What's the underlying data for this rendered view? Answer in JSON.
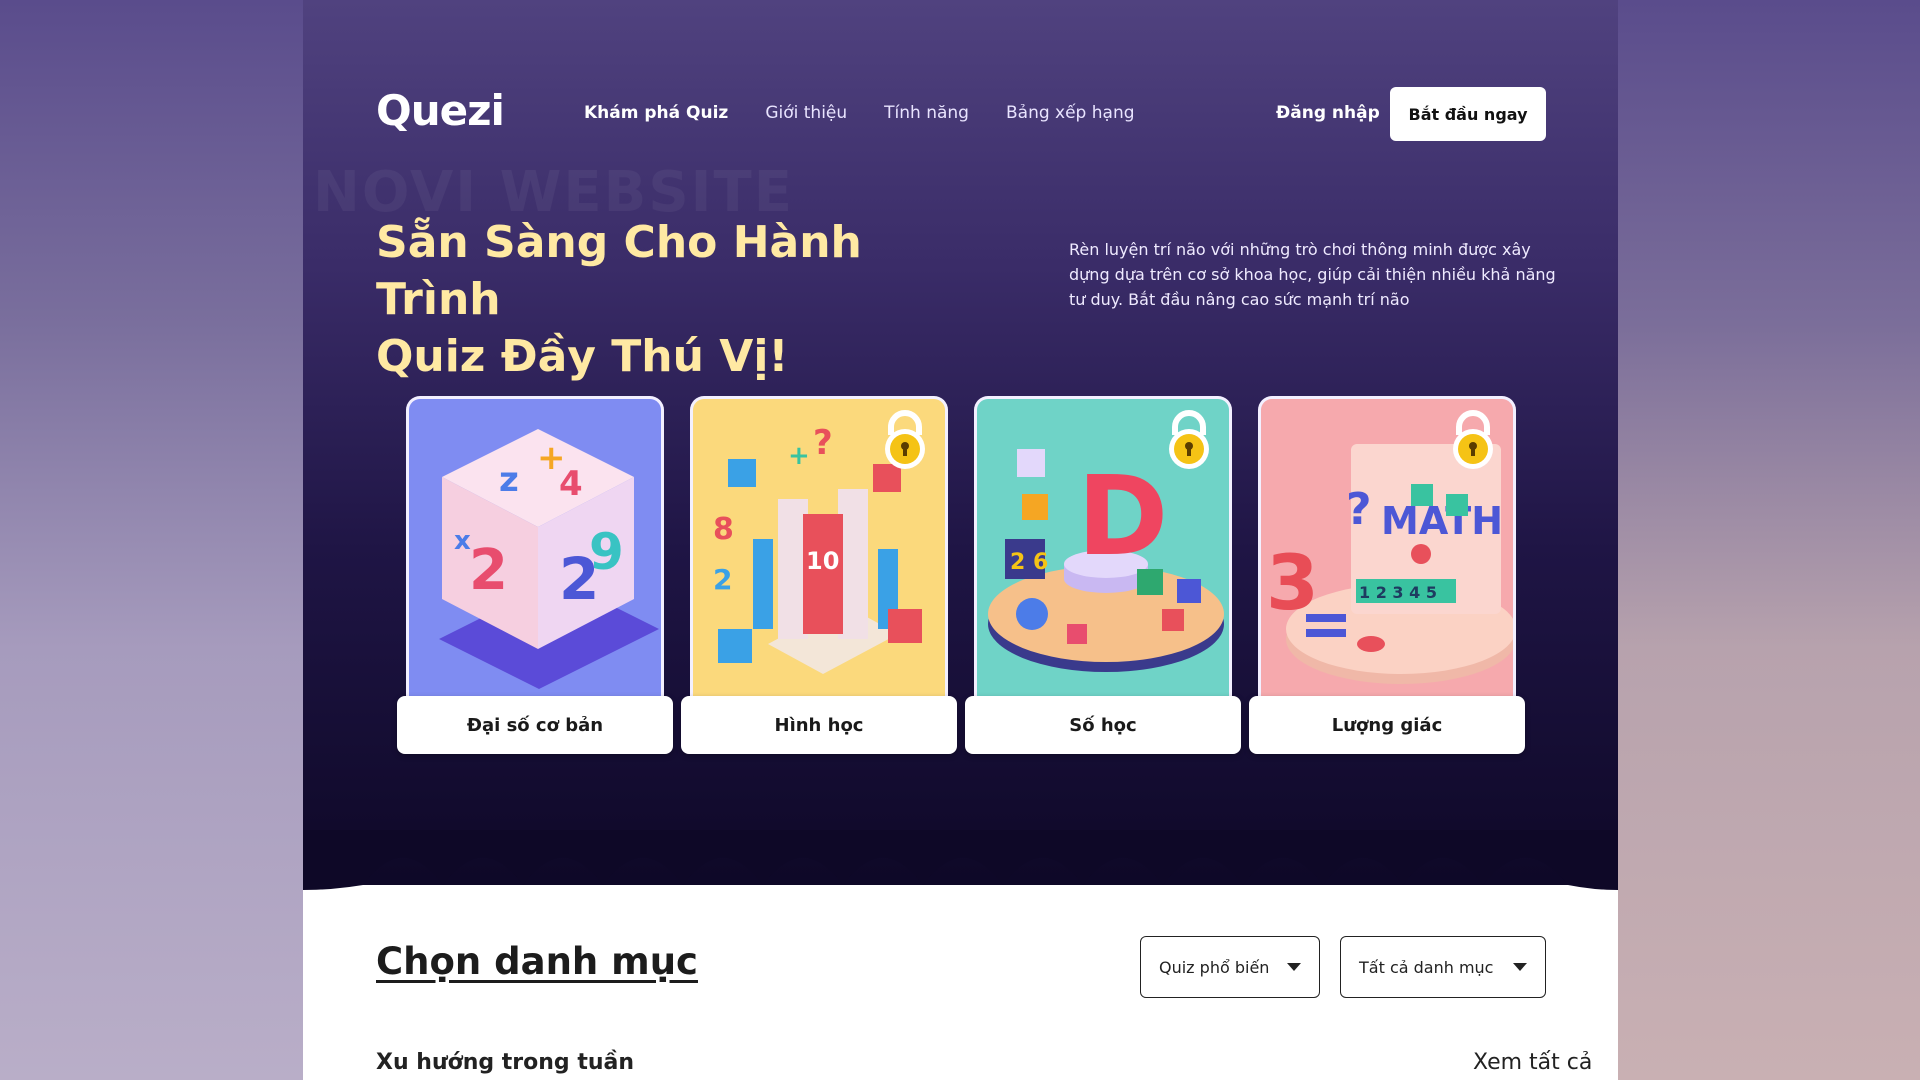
{
  "brand": {
    "logo": "Quezi"
  },
  "nav": {
    "items": [
      {
        "label": "Khám phá Quiz",
        "active": true
      },
      {
        "label": "Giới thiệu",
        "active": false
      },
      {
        "label": "Tính năng",
        "active": false
      },
      {
        "label": "Bảng xếp hạng",
        "active": false
      }
    ],
    "login_label": "Đăng nhập",
    "start_label": "Bắt đầu ngay"
  },
  "hero": {
    "headline_line1": "Sẵn Sàng Cho Hành Trình",
    "headline_line2": "Quiz Đầy Thú Vị!",
    "description": "Rèn luyện trí não với những trò chơi thông minh được xây dựng dựa trên cơ sở khoa học, giúp cải thiện nhiều khả năng tư duy. Bắt đầu nâng cao sức mạnh trí não"
  },
  "cards": [
    {
      "label": "Đại số cơ bản",
      "locked": false,
      "color": "#7f8cf2",
      "art_text": ""
    },
    {
      "label": "Hình học",
      "locked": true,
      "color": "#fbd97c",
      "art_text": "10"
    },
    {
      "label": "Số học",
      "locked": true,
      "color": "#6fd3c7",
      "art_text": "D"
    },
    {
      "label": "Lượng giác",
      "locked": true,
      "color": "#f6a9ad",
      "art_text": "MATH"
    }
  ],
  "categories": {
    "title": "Chọn danh mục",
    "filter_popular": "Quiz phổ biến",
    "filter_all": "Tất cả danh mục"
  },
  "trending": {
    "title": "Xu hướng trong tuần",
    "see_all": "Xem tất cả"
  },
  "colors": {
    "headline": "#ffe9a3",
    "hero_top": "#50427f",
    "hero_bottom": "#0e0827"
  }
}
